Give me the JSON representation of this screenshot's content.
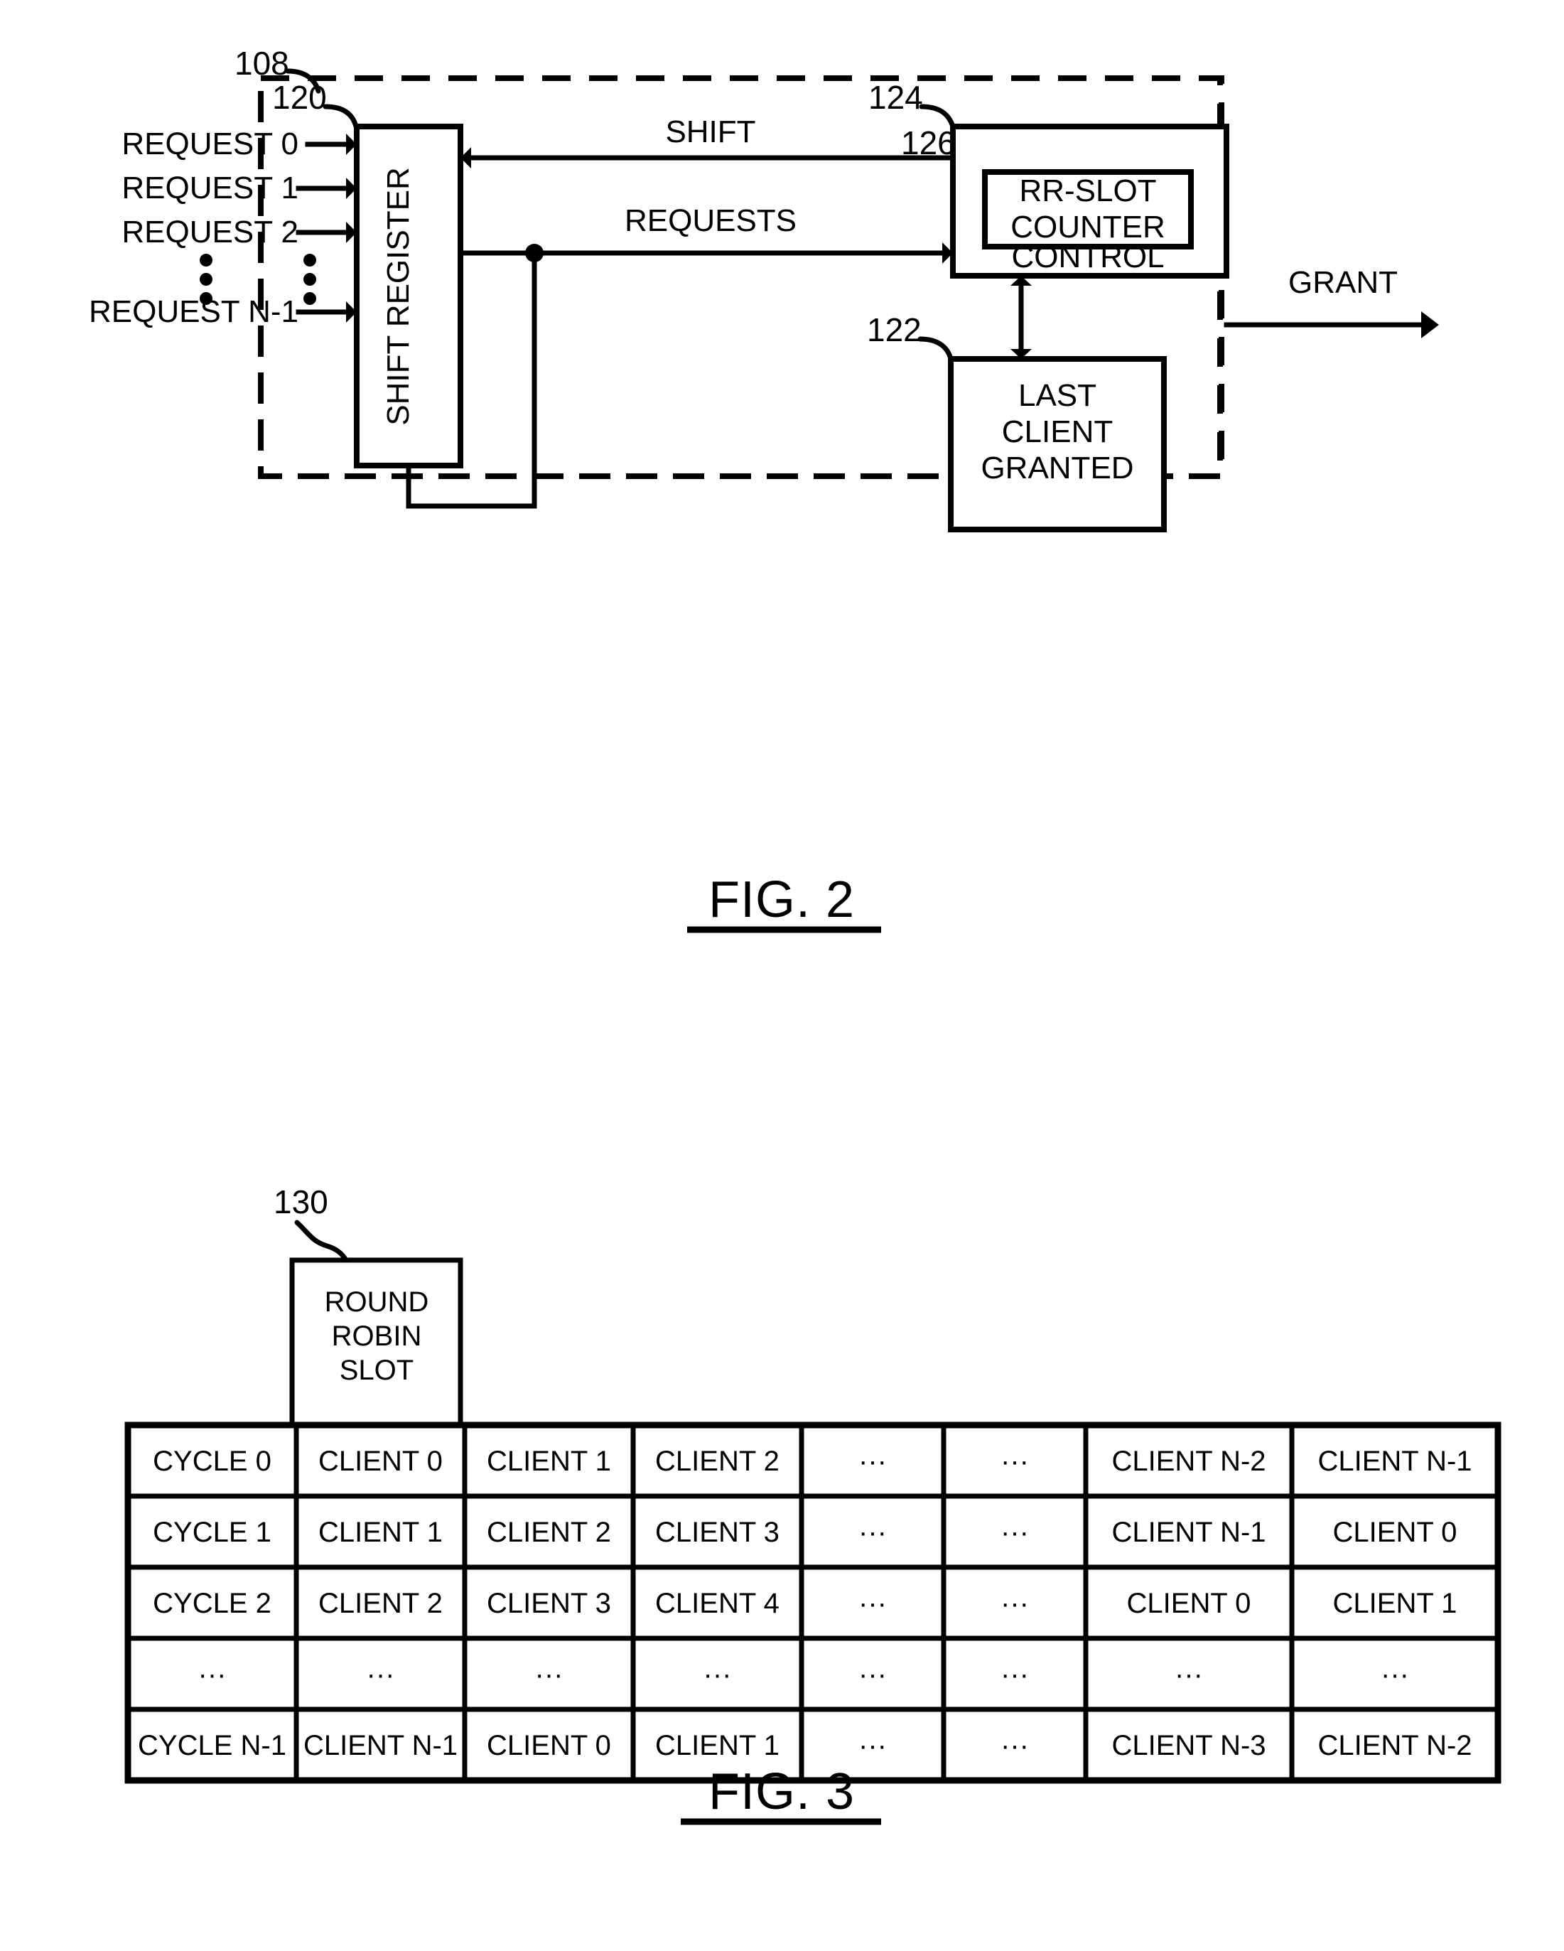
{
  "figures": [
    {
      "id": "fig2",
      "caption": "FIG. 2",
      "reference_numerals": {
        "arbiter": "108",
        "shift_register": "120",
        "last_client_granted": "122",
        "control": "124",
        "rr_slot_counter": "126"
      },
      "inputs": [
        "REQUEST 0",
        "REQUEST 1",
        "REQUEST 2",
        "REQUEST N-1"
      ],
      "input_ellipsis": "•••",
      "blocks": {
        "shift_register": "SHIFT REGISTER",
        "control": "CONTROL",
        "rr_slot_counter_line1": "RR-SLOT",
        "rr_slot_counter_line2": "COUNTER",
        "last_client_granted_line1": "LAST",
        "last_client_granted_line2": "CLIENT",
        "last_client_granted_line3": "GRANTED"
      },
      "signals": {
        "shift": "SHIFT",
        "requests": "REQUESTS",
        "grant": "GRANT"
      }
    },
    {
      "id": "fig3",
      "caption": "FIG. 3",
      "reference_numerals": {
        "round_robin_slot": "130"
      },
      "header_box": {
        "line1": "ROUND",
        "line2": "ROBIN",
        "line3": "SLOT"
      },
      "table": {
        "ellipsis": "···",
        "rows": [
          [
            "CYCLE 0",
            "CLIENT 0",
            "CLIENT 1",
            "CLIENT 2",
            "···",
            "···",
            "CLIENT N-2",
            "CLIENT N-1"
          ],
          [
            "CYCLE 1",
            "CLIENT 1",
            "CLIENT 2",
            "CLIENT 3",
            "···",
            "···",
            "CLIENT N-1",
            "CLIENT 0"
          ],
          [
            "CYCLE 2",
            "CLIENT 2",
            "CLIENT 3",
            "CLIENT 4",
            "···",
            "···",
            "CLIENT 0",
            "CLIENT 1"
          ],
          [
            "···",
            "···",
            "···",
            "···",
            "···",
            "···",
            "···",
            "···"
          ],
          [
            "CYCLE N-1",
            "CLIENT N-1",
            "CLIENT 0",
            "CLIENT 1",
            "···",
            "···",
            "CLIENT N-3",
            "CLIENT N-2"
          ]
        ]
      }
    }
  ],
  "colors": {
    "ink": "#000000",
    "paper": "#ffffff"
  }
}
